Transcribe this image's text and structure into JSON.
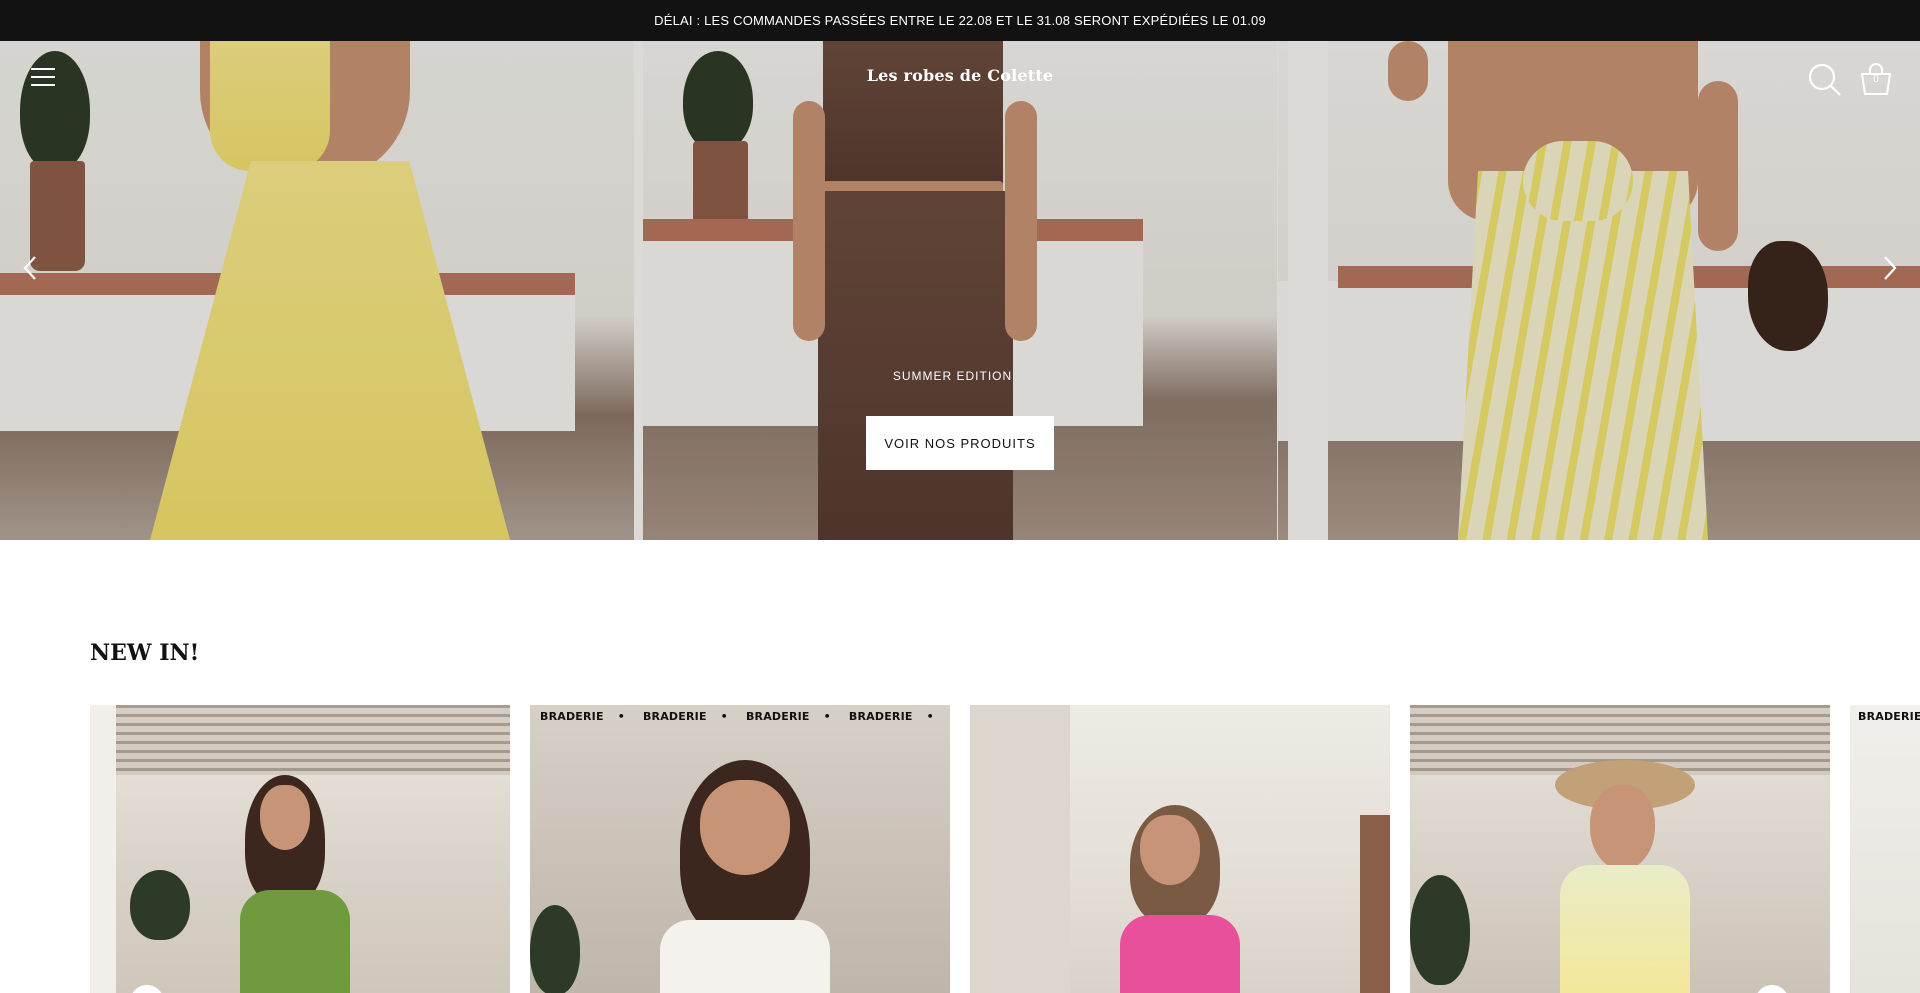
{
  "announcement": {
    "text": "DÉLAI : LES COMMANDES PASSÉES ENTRE LE 22.08 ET LE 31.08 SERONT EXPÉDIÉES LE 01.09"
  },
  "header": {
    "logo": "Les robes de Colette",
    "cart_count": "0",
    "icons": [
      "menu-icon",
      "search-icon",
      "cart-icon"
    ]
  },
  "hero": {
    "kicker": "SUMMER EDITION",
    "button_label": "VOIR NOS PRODUITS",
    "arrows": [
      "chevron-left-icon",
      "chevron-right-icon"
    ]
  },
  "new_in": {
    "title": "NEW IN!",
    "ticker_word": "BRADERIE",
    "cards": [
      {
        "badge": ""
      },
      {
        "badge": "BRADERIE"
      },
      {
        "badge": ""
      },
      {
        "badge": ""
      },
      {
        "badge": "BRADERIE"
      }
    ]
  }
}
